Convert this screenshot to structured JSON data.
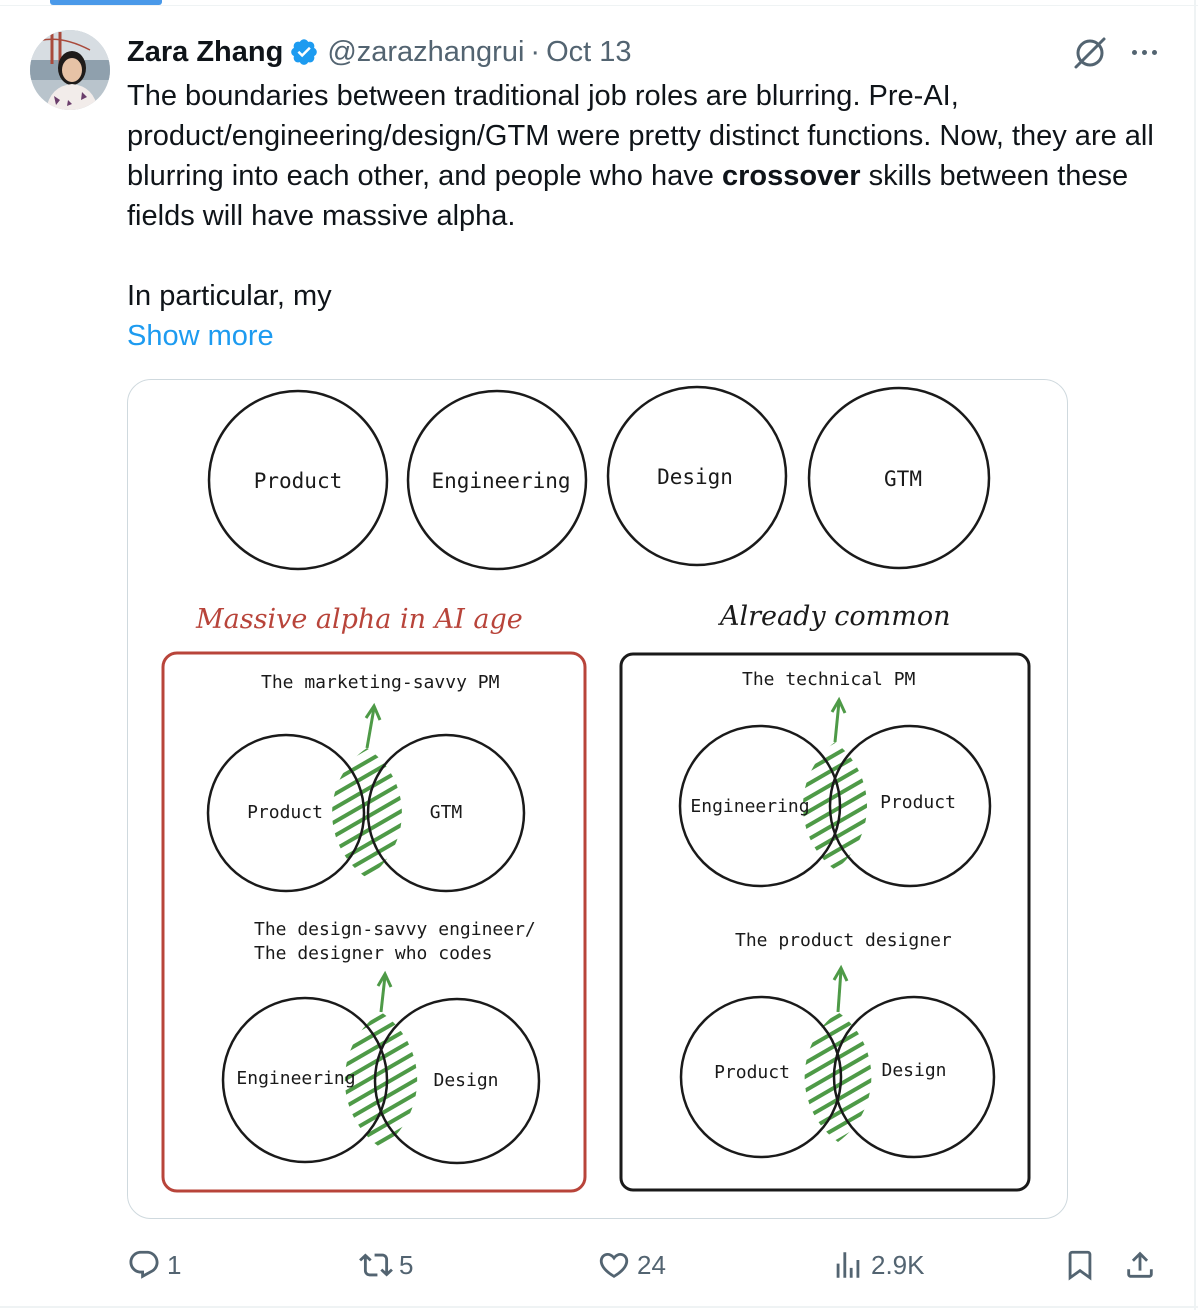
{
  "tweet": {
    "author_name": "Zara Zhang",
    "handle": "@zarazhangrui",
    "separator": "·",
    "date": "Oct 13",
    "text_part1": "The boundaries between traditional job roles are blurring. Pre-AI, product/engineering/design/GTM were pretty distinct functions. Now, they are all blurring into each other, and people who have ",
    "text_bold": "crossover",
    "text_part2": " skills between these fields will have massive alpha.",
    "text_part3": "In particular, my",
    "show_more": "Show more"
  },
  "diagram": {
    "circles": [
      "Product",
      "Engineering",
      "Design",
      "GTM"
    ],
    "left_heading": "Massive alpha in AI age",
    "right_heading": "Already common",
    "left_box": {
      "venn1": {
        "title": "The marketing-savvy PM",
        "left": "Product",
        "right": "GTM"
      },
      "venn2": {
        "title_line1": "The design-savvy engineer/",
        "title_line2": "The designer who codes",
        "left": "Engineering",
        "right": "Design"
      }
    },
    "right_box": {
      "venn1": {
        "title": "The technical PM",
        "left": "Engineering",
        "right": "Product"
      },
      "venn2": {
        "title": "The product designer",
        "left": "Product",
        "right": "Design"
      }
    },
    "colors": {
      "red": "#b8443a",
      "green": "#4e9a47",
      "black": "#1a1a1a"
    }
  },
  "actions": {
    "reply_count": "1",
    "repost_count": "5",
    "like_count": "24",
    "views_count": "2.9K"
  },
  "icons": [
    "verified-badge-icon",
    "grok-icon",
    "more-icon",
    "reply-icon",
    "repost-icon",
    "like-icon",
    "views-icon",
    "bookmark-icon",
    "share-icon"
  ]
}
